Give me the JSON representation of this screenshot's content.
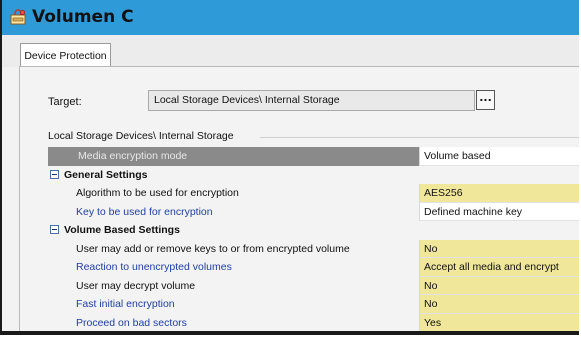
{
  "window": {
    "title": "Volumen C",
    "icon": "disk-lock-icon"
  },
  "tabs": [
    {
      "label": "Device Protection",
      "selected": true
    }
  ],
  "target": {
    "label": "Target:",
    "value": "Local Storage Devices\\ Internal Storage",
    "browse_label": "..."
  },
  "group": {
    "label": "Local Storage Devices\\ Internal Storage"
  },
  "settings": {
    "encryption_mode": {
      "name": "Media encryption mode",
      "value": "Volume based"
    },
    "general": {
      "title": "General Settings",
      "algorithm": {
        "name": "Algorithm to be used for encryption",
        "value": "AES256"
      },
      "key": {
        "name": "Key to be used for encryption",
        "value": "Defined machine key"
      }
    },
    "volume_based": {
      "title": "Volume Based Settings",
      "add_remove_keys": {
        "name": "User may add or remove keys to or from encrypted volume",
        "value": "No"
      },
      "unencrypted_reaction": {
        "name": "Reaction to unencrypted volumes",
        "value": "Accept all media and encrypt"
      },
      "decrypt_volume": {
        "name": "User may decrypt volume",
        "value": "No"
      },
      "fast_initial": {
        "name": "Fast initial encryption",
        "value": "No"
      },
      "bad_sectors": {
        "name": "Proceed on bad sectors",
        "value": "Yes"
      }
    }
  },
  "colors": {
    "titlebar": "#2f9ad8",
    "value_highlight": "#f0e79a",
    "link_text": "#1f3ea8",
    "selected_row": "#8a8a8a"
  }
}
